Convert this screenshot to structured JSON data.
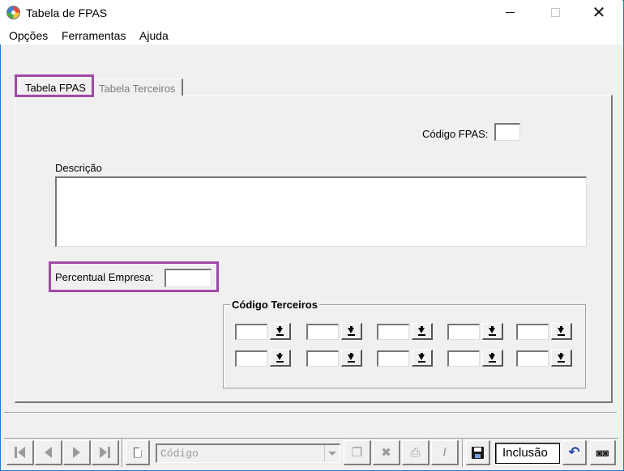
{
  "window": {
    "title": "Tabela de FPAS"
  },
  "menu": {
    "items": [
      "Opções",
      "Ferramentas",
      "Ajuda"
    ]
  },
  "tabs": [
    {
      "label": "Tabela FPAS",
      "active": true
    },
    {
      "label": "Tabela Terceiros",
      "active": false
    }
  ],
  "form": {
    "codigo_fpas_label": "Código FPAS:",
    "codigo_fpas_value": "",
    "descricao_label": "Descrição",
    "descricao_value": "",
    "percentual_label": "Percentual Empresa:",
    "percentual_value": "",
    "terceiros_group_label": "Código Terceiros",
    "terceiros_values": [
      "",
      "",
      "",
      "",
      "",
      "",
      "",
      "",
      "",
      ""
    ]
  },
  "toolbar": {
    "codigo_placeholder": "Código",
    "mode_text": "Inclusão"
  },
  "colors": {
    "highlight": "#a04aa6",
    "window_border": "#1e7ad8",
    "face": "#f0f0f0"
  },
  "icons": [
    "first-record-icon",
    "prev-record-icon",
    "next-record-icon",
    "last-record-icon",
    "new-document-icon",
    "copy-icon",
    "delete-icon",
    "print-icon",
    "italic-icon",
    "save-icon",
    "undo-icon",
    "binoculars-icon",
    "download-arrow-icon"
  ]
}
